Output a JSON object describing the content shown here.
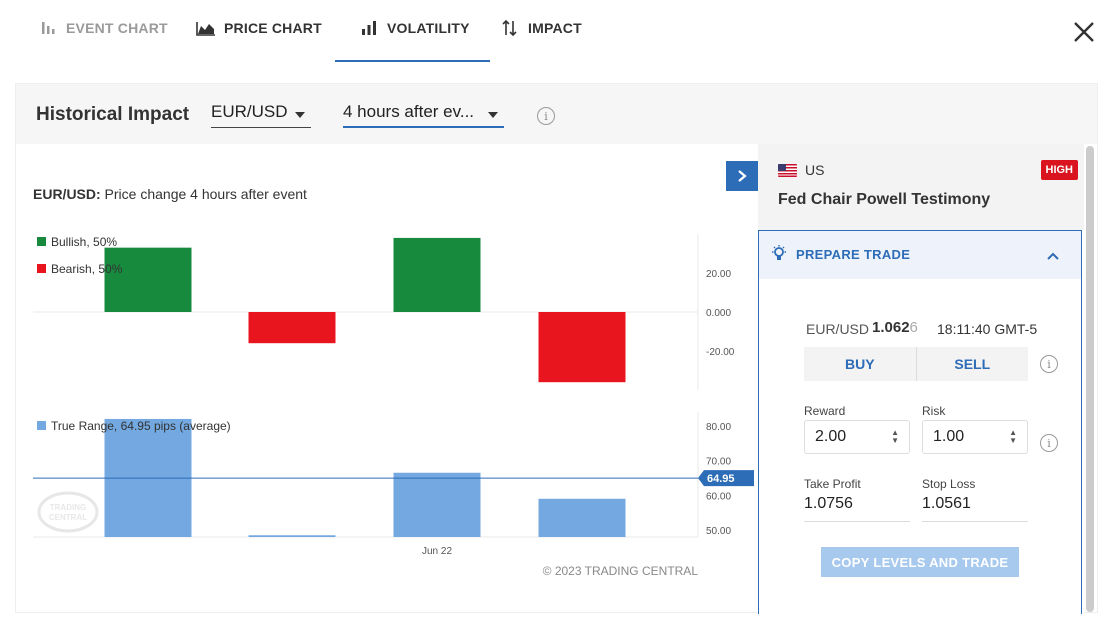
{
  "tabs": [
    {
      "label": "EVENT CHART",
      "icon": "bar-chart-icon"
    },
    {
      "label": "PRICE CHART",
      "icon": "area-chart-icon"
    },
    {
      "label": "VOLATILITY",
      "icon": "signal-bars-icon"
    },
    {
      "label": "IMPACT",
      "icon": "swap-vertical-icon"
    }
  ],
  "active_tab": "VOLATILITY",
  "header": {
    "title": "Historical Impact",
    "pair_select": "EUR/USD",
    "period_select": "4 hours after ev..."
  },
  "chart": {
    "title_pair": "EUR/USD:",
    "title_rest": " Price change 4 hours after event",
    "copyright": "© 2023 TRADING CENTRAL",
    "watermark": "TRADING CENTRAL"
  },
  "chart_data": [
    {
      "type": "bar",
      "categories": [
        "",
        "",
        "",
        ""
      ],
      "series": [
        {
          "name": "Bullish, 50%",
          "values": [
            33,
            null,
            38,
            null
          ],
          "color": "#178a3e"
        },
        {
          "name": "Bearish, 50%",
          "values": [
            null,
            -16,
            null,
            -36
          ],
          "color": "#e8141e"
        }
      ],
      "y_ticks": [
        "20.00",
        "0.000",
        "-20.00"
      ],
      "ylim": [
        -40,
        40
      ],
      "legend": "top-left"
    },
    {
      "type": "bar",
      "categories": [
        "",
        "",
        "Jun 22",
        ""
      ],
      "series": [
        {
          "name": "True Range, 64.95 pips (average)",
          "values": [
            82,
            48.5,
            66.5,
            59
          ],
          "color": "#73a8e0"
        }
      ],
      "average": {
        "value": 64.95,
        "label": "64.95"
      },
      "y_ticks": [
        "80.00",
        "70.00",
        "60.00",
        "50.00"
      ],
      "ylim": [
        48,
        84
      ],
      "x_label": "Jun 22",
      "legend": "top-left"
    }
  ],
  "panel": {
    "country": "US",
    "impact": "HIGH",
    "event": "Fed Chair Powell Testimony",
    "prepare_label": "PREPARE TRADE",
    "pair": "EUR/USD",
    "price_main": "1.062",
    "price_last": "6",
    "time": "18:11:40 GMT-5",
    "buy_label": "BUY",
    "sell_label": "SELL",
    "reward_label": "Reward",
    "reward_value": "2.00",
    "risk_label": "Risk",
    "risk_value": "1.00",
    "tp_label": "Take Profit",
    "tp_value": "1.0756",
    "sl_label": "Stop Loss",
    "sl_value": "1.0561",
    "copy_label": "COPY LEVELS AND TRADE"
  },
  "colors": {
    "accent": "#2d6cb7",
    "bullish": "#178a3e",
    "bearish": "#e8141e",
    "range": "#73a8e0",
    "high_badge": "#d9141e"
  }
}
